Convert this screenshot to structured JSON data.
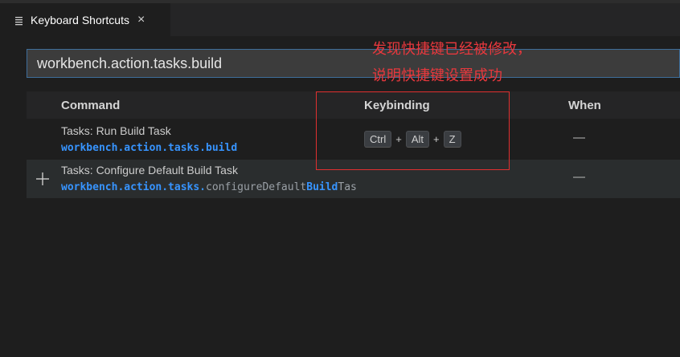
{
  "tab": {
    "title": "Keyboard Shortcuts",
    "close": "×"
  },
  "search": {
    "value": "workbench.action.tasks.build"
  },
  "columns": {
    "command": "Command",
    "keybinding": "Keybinding",
    "when": "When"
  },
  "rows": [
    {
      "title": "Tasks: Run Build Task",
      "id": "workbench.action.tasks.build",
      "keys": [
        "Ctrl",
        "Alt",
        "Z"
      ],
      "when": "—"
    },
    {
      "title": "Tasks: Configure Default Build Task",
      "id_prefix": "workbench.action.tasks.",
      "id_mid": "configureDefault",
      "id_hl": "Build",
      "id_suffix": "Tas",
      "when": "—"
    }
  ],
  "annotation": {
    "line1": "发现快捷键已经被修改，",
    "line2": "说明快捷键设置成功"
  },
  "colors": {
    "annotation": "#e8383d",
    "highlight": "#3794ff"
  }
}
